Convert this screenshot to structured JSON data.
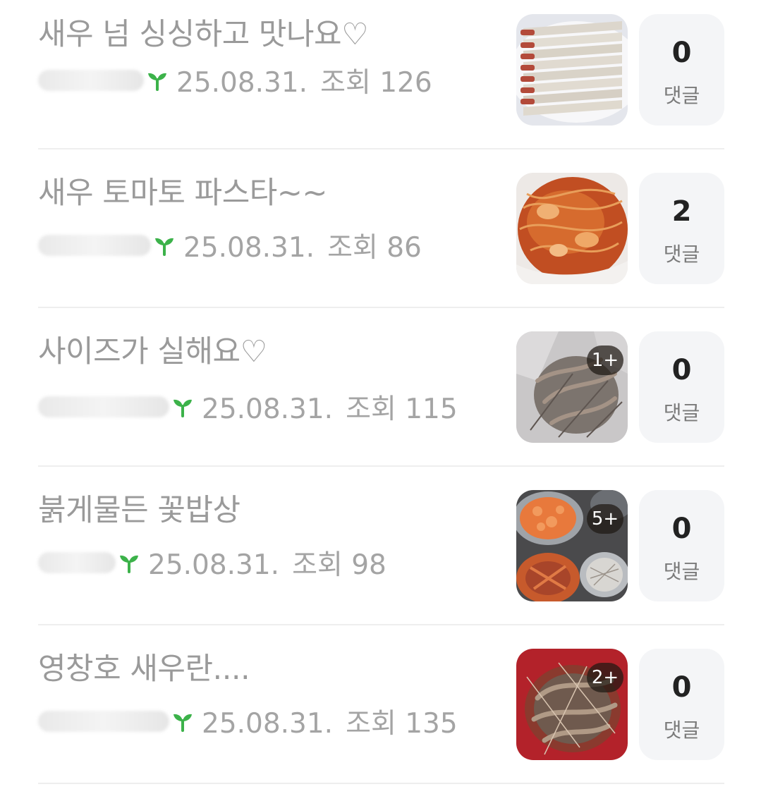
{
  "posts": [
    {
      "title": "새우 넘 싱싱하고 맛나요♡",
      "date": "25.08.31.",
      "views": "조회 126",
      "image_count": "",
      "comment_count": "0",
      "comment_label": "댓글",
      "image": "shrimp-raw-plate"
    },
    {
      "title": "새우 토마토 파스타~~",
      "date": "25.08.31.",
      "views": "조회 86",
      "image_count": "",
      "comment_count": "2",
      "comment_label": "댓글",
      "image": "tomato-pasta"
    },
    {
      "title": "사이즈가 실해요♡",
      "date": "25.08.31.",
      "views": "조회 115",
      "image_count": "1+",
      "comment_count": "0",
      "comment_label": "댓글",
      "image": "shrimp-bag"
    },
    {
      "title": "붉게물든 꽃밥상",
      "date": "25.08.31.",
      "views": "조회 98",
      "image_count": "5+",
      "comment_count": "0",
      "comment_label": "댓글",
      "image": "seafood-table"
    },
    {
      "title": "영창호 새우란....",
      "date": "25.08.31.",
      "views": "조회 135",
      "image_count": "2+",
      "comment_count": "0",
      "comment_label": "댓글",
      "image": "shrimp-red-basin"
    }
  ],
  "colors": {
    "title": "#9a9a9a",
    "meta": "#a4a4a4",
    "sprout": "#3cb24a",
    "comment_bg": "#f4f5f7"
  },
  "icons": {
    "level": "sprout-icon"
  }
}
